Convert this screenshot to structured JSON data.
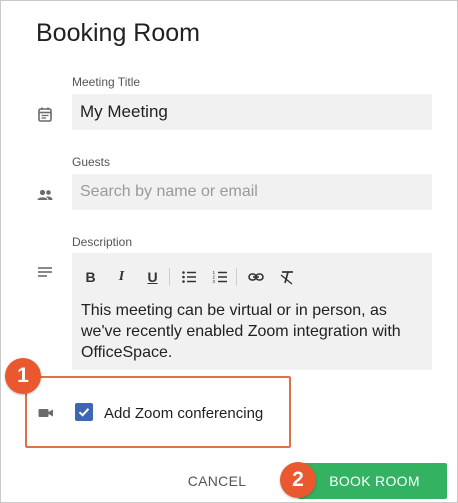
{
  "dialog": {
    "title": "Booking Room"
  },
  "meeting_title": {
    "label": "Meeting Title",
    "value": "My Meeting",
    "icon": "calendar-icon"
  },
  "guests": {
    "label": "Guests",
    "placeholder": "Search by name or email",
    "icon": "people-icon"
  },
  "description": {
    "label": "Description",
    "icon": "notes-icon",
    "toolbar": [
      "bold-icon",
      "italic-icon",
      "underline-icon",
      "bulleted-list-icon",
      "numbered-list-icon",
      "link-icon",
      "clear-format-icon"
    ],
    "toolbar_glyphs": {
      "bold": "B",
      "italic": "I",
      "underline": "U"
    },
    "text": "This meeting can be virtual or in person, as we've recently enabled Zoom integration with OfficeSpace."
  },
  "zoom": {
    "label": "Add Zoom conferencing",
    "checked": true,
    "icon": "video-camera-icon"
  },
  "actions": {
    "cancel_label": "CANCEL",
    "book_label": "BOOK ROOM"
  },
  "callouts": {
    "badge1": "1",
    "badge2": "2"
  },
  "colors": {
    "accent_green": "#33b261",
    "checkbox_blue": "#3d67b5",
    "callout_orange": "#e9582e"
  }
}
